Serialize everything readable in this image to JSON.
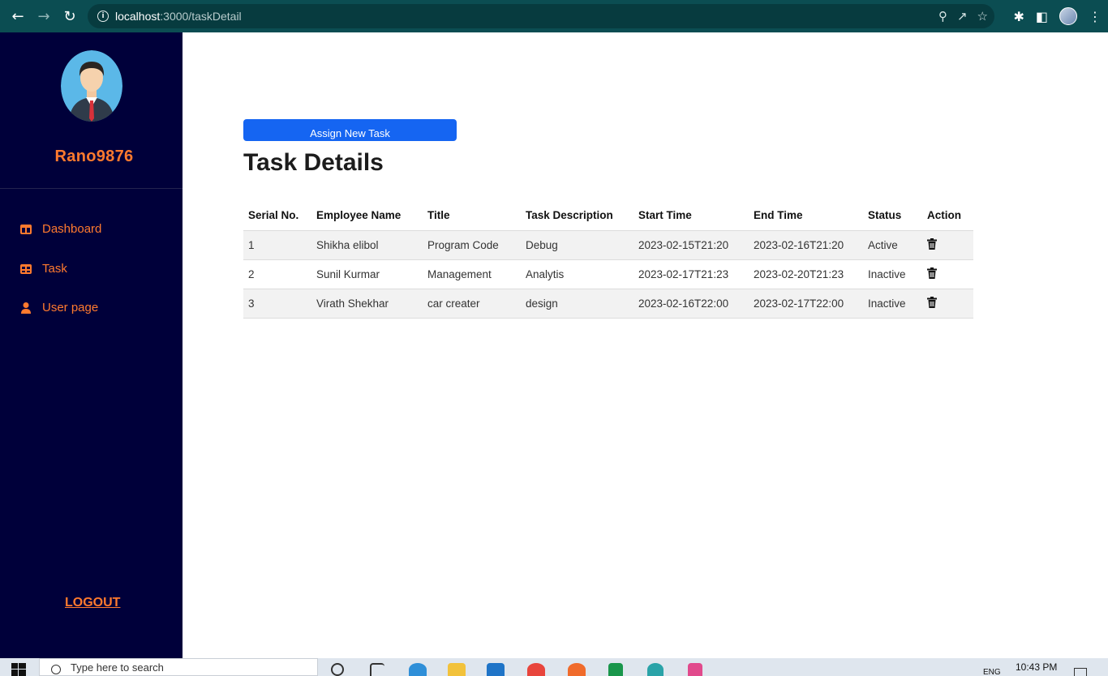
{
  "browser": {
    "url_host": "localhost",
    "url_path": ":3000/taskDetail"
  },
  "sidebar": {
    "username": "Rano9876",
    "items": [
      {
        "label": "Dashboard",
        "icon": "dashboard-icon"
      },
      {
        "label": "Task",
        "icon": "table-icon"
      },
      {
        "label": "User page",
        "icon": "user-icon"
      }
    ],
    "logout_label": "LOGOUT"
  },
  "main": {
    "assign_label": "Assign New Task",
    "title": "Task Details",
    "table": {
      "headers": [
        "Serial No.",
        "Employee Name",
        "Title",
        "Task Description",
        "Start Time",
        "End Time",
        "Status",
        "Action"
      ],
      "rows": [
        [
          "1",
          "Shikha elibol",
          "Program Code",
          "Debug",
          "2023-02-15T21:20",
          "2023-02-16T21:20",
          "Active"
        ],
        [
          "2",
          "Sunil Kurmar",
          "Management",
          "Analytis",
          "2023-02-17T21:23",
          "2023-02-20T21:23",
          "Inactive"
        ],
        [
          "3",
          "Virath Shekhar",
          "car creater",
          "design",
          "2023-02-16T22:00",
          "2023-02-17T22:00",
          "Inactive"
        ]
      ]
    }
  },
  "taskbar": {
    "search_placeholder": "Type here to search",
    "language": "ENG",
    "time": "10:43 PM"
  },
  "colors": {
    "sidebar_bg": "#00003a",
    "accent_orange": "#ff7a2e",
    "primary_button": "#1565f2",
    "chrome_bg": "#0b4d52"
  }
}
